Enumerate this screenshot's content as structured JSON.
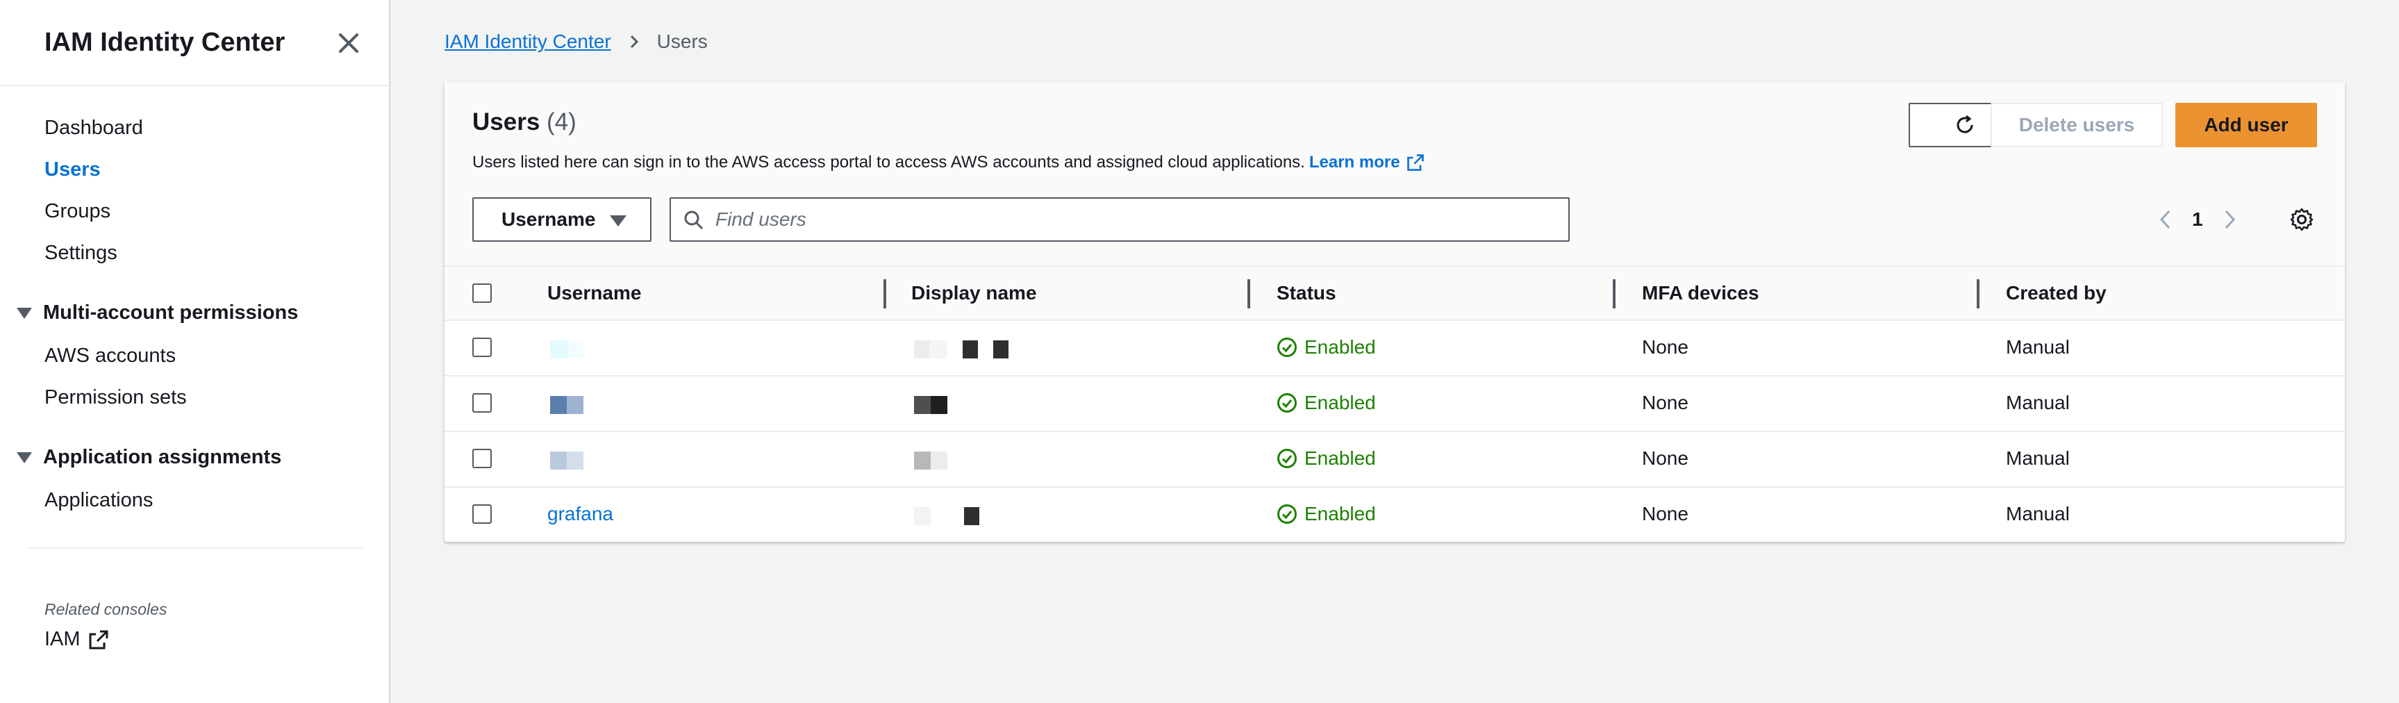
{
  "sidebar": {
    "title": "IAM Identity Center",
    "items": [
      {
        "label": "Dashboard"
      },
      {
        "label": "Users"
      },
      {
        "label": "Groups"
      },
      {
        "label": "Settings"
      }
    ],
    "section_multi": {
      "label": "Multi-account permissions",
      "items": [
        {
          "label": "AWS accounts"
        },
        {
          "label": "Permission sets"
        }
      ]
    },
    "section_app": {
      "label": "Application assignments",
      "items": [
        {
          "label": "Applications"
        }
      ]
    },
    "related_label": "Related consoles",
    "iam_label": "IAM"
  },
  "breadcrumb": {
    "root": "IAM Identity Center",
    "current": "Users"
  },
  "panel": {
    "title": "Users",
    "count": "(4)",
    "description": "Users listed here can sign in to the AWS access portal to access AWS accounts and assigned cloud applications.",
    "learn_more": "Learn more",
    "delete_label": "Delete users",
    "add_label": "Add user",
    "filter_property": "Username",
    "search_placeholder": "Find users",
    "page": "1"
  },
  "table": {
    "headers": [
      "Username",
      "Display name",
      "Status",
      "MFA devices",
      "Created by"
    ],
    "rows": [
      {
        "username": "",
        "status": "Enabled",
        "mfa": "None",
        "created_by": "Manual"
      },
      {
        "username": "",
        "status": "Enabled",
        "mfa": "None",
        "created_by": "Manual"
      },
      {
        "username": "",
        "status": "Enabled",
        "mfa": "None",
        "created_by": "Manual"
      },
      {
        "username": "grafana",
        "status": "Enabled",
        "mfa": "None",
        "created_by": "Manual"
      }
    ]
  },
  "colors": {
    "link": "#0972d3",
    "primary_button": "#ec9331",
    "success": "#1d8102",
    "text": "#16191f"
  },
  "icons": [
    "close-icon",
    "chevron-right-icon",
    "caret-down-icon",
    "refresh-icon",
    "external-link-icon",
    "search-icon",
    "chevron-left-icon",
    "gear-icon",
    "check-circle-icon"
  ]
}
